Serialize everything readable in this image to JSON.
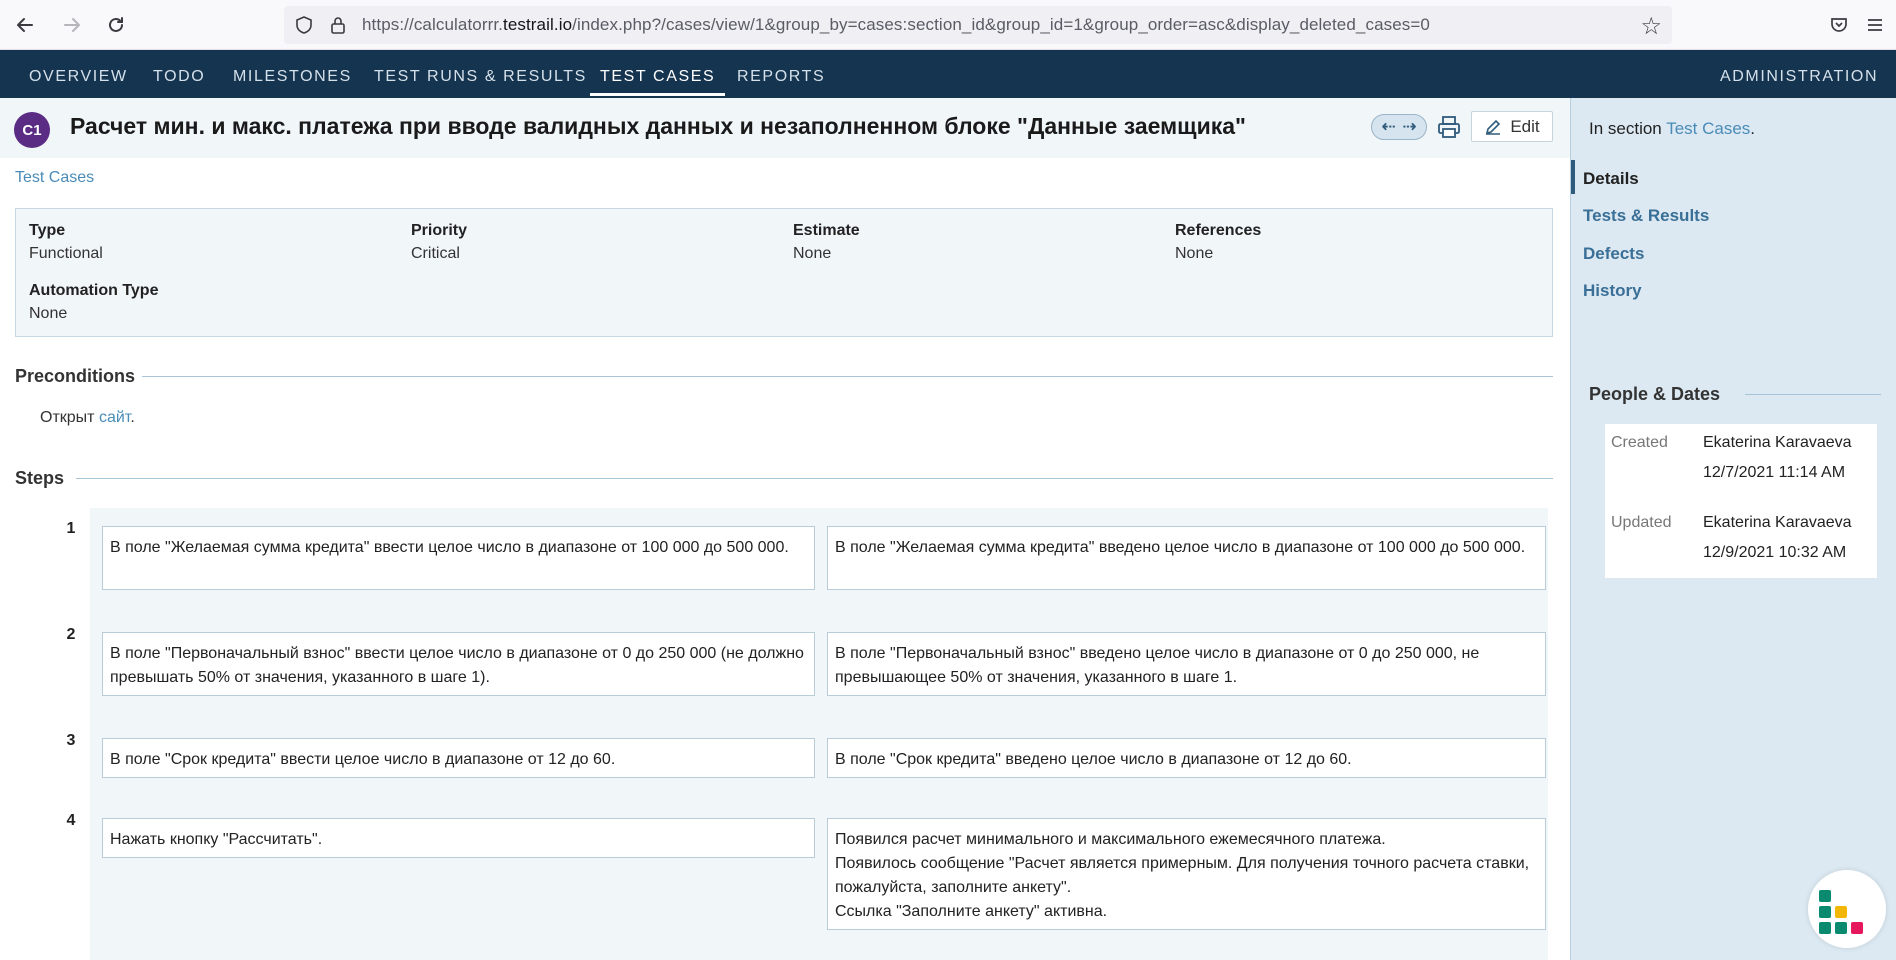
{
  "browser": {
    "url_prefix": "https://calculatorrr.",
    "url_host": "testrail.io",
    "url_suffix": "/index.php?/cases/view/1&group_by=cases:section_id&group_id=1&group_order=asc&display_deleted_cases=0"
  },
  "nav": {
    "tabs": [
      {
        "label": "OVERVIEW"
      },
      {
        "label": "TODO"
      },
      {
        "label": "MILESTONES"
      },
      {
        "label": "TEST RUNS & RESULTS"
      },
      {
        "label": "TEST CASES"
      },
      {
        "label": "REPORTS"
      }
    ],
    "active_tab": "TEST CASES",
    "admin_label": "ADMINISTRATION"
  },
  "case": {
    "id": "C1",
    "title": "Расчет мин. и макс. платежа при вводе валидных данных и незаполненном блоке \"Данные заемщика\"",
    "edit_label": "Edit",
    "breadcrumb": "Test Cases",
    "fields": [
      {
        "label": "Type",
        "value": "Functional"
      },
      {
        "label": "Priority",
        "value": "Critical"
      },
      {
        "label": "Estimate",
        "value": "None"
      },
      {
        "label": "References",
        "value": "None"
      },
      {
        "label": "Automation Type",
        "value": "None"
      }
    ],
    "preconditions_title": "Preconditions",
    "preconditions_text": "Открыт",
    "preconditions_link": "сайт",
    "preconditions_end": ".",
    "steps_title": "Steps",
    "steps": [
      {
        "num": "1",
        "action": "В поле \"Желаемая сумма кредита\" ввести целое число в диапазоне от 100 000 до 500 000.",
        "expected": "В поле \"Желаемая сумма кредита\" введено целое число в диапазоне от 100 000 до 500 000."
      },
      {
        "num": "2",
        "action": "В поле \"Первоначальный взнос\" ввести целое число в диапазоне от 0 до 250 000 (не должно превышать 50% от значения, указанного в шаге 1).",
        "expected": "В поле \"Первоначальный взнос\" введено целое число в диапазоне от 0 до 250 000, не превышающее 50% от значения, указанного в шаге 1."
      },
      {
        "num": "3",
        "action": "В поле \"Срок кредита\" ввести целое число в диапазоне от 12 до 60.",
        "expected": "В поле \"Срок кредита\" введено целое число в диапазоне от 12 до 60."
      },
      {
        "num": "4",
        "action": "Нажать кнопку \"Рассчитать\".",
        "expected_lines": [
          "Появился расчет минимального и максимального ежемесячного платежа.",
          "Появилось сообщение \"Расчет является примерным. Для получения точного расчета ставки, пожалуйста, заполните анкету\".",
          "Ссылка \"Заполните анкету\" активна."
        ]
      }
    ]
  },
  "sidebar": {
    "in_section_prefix": "In section",
    "in_section_link": "Test Cases",
    "in_section_suffix": ".",
    "nav": [
      {
        "label": "Details"
      },
      {
        "label": "Tests & Results"
      },
      {
        "label": "Defects"
      },
      {
        "label": "History"
      }
    ],
    "people_title": "People & Dates",
    "created_label": "Created",
    "created_by": "Ekaterina Karavaeva",
    "created_at": "12/7/2021 11:14 AM",
    "updated_label": "Updated",
    "updated_by": "Ekaterina Karavaeva",
    "updated_at": "12/9/2021 10:32 AM"
  }
}
